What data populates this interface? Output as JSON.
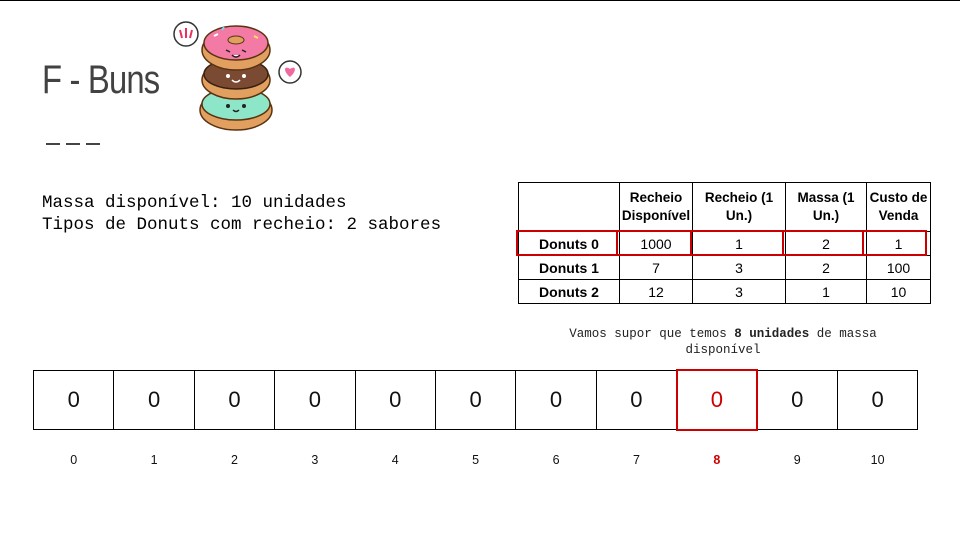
{
  "slide": {
    "title": "F - Buns",
    "info_lines": [
      "Massa disponível: 10 unidades",
      "Tipos de Donuts com recheio: 2 sabores"
    ],
    "image_icon": "stacked-donuts-illustration"
  },
  "table": {
    "headers": [
      "",
      "Recheio Disponível",
      "Recheio (1 Un.)",
      "Massa (1 Un.)",
      "Custo de Venda"
    ],
    "rows": [
      {
        "label": "Donuts 0",
        "values": [
          "1000",
          "1",
          "2",
          "1"
        ],
        "highlighted": true
      },
      {
        "label": "Donuts 1",
        "values": [
          "7",
          "3",
          "2",
          "100"
        ],
        "highlighted": false
      },
      {
        "label": "Donuts 2",
        "values": [
          "12",
          "3",
          "1",
          "10"
        ],
        "highlighted": false
      }
    ]
  },
  "note": {
    "prefix": "Vamos supor que temos ",
    "bold": "8 unidades",
    "suffix": " de massa disponível"
  },
  "dp_array": {
    "values": [
      "0",
      "0",
      "0",
      "0",
      "0",
      "0",
      "0",
      "0",
      "0",
      "0",
      "0"
    ],
    "indices": [
      "0",
      "1",
      "2",
      "3",
      "4",
      "5",
      "6",
      "7",
      "8",
      "9",
      "10"
    ],
    "highlight_index": 8
  },
  "colors": {
    "highlight": "#cc0000",
    "title": "#424242"
  }
}
